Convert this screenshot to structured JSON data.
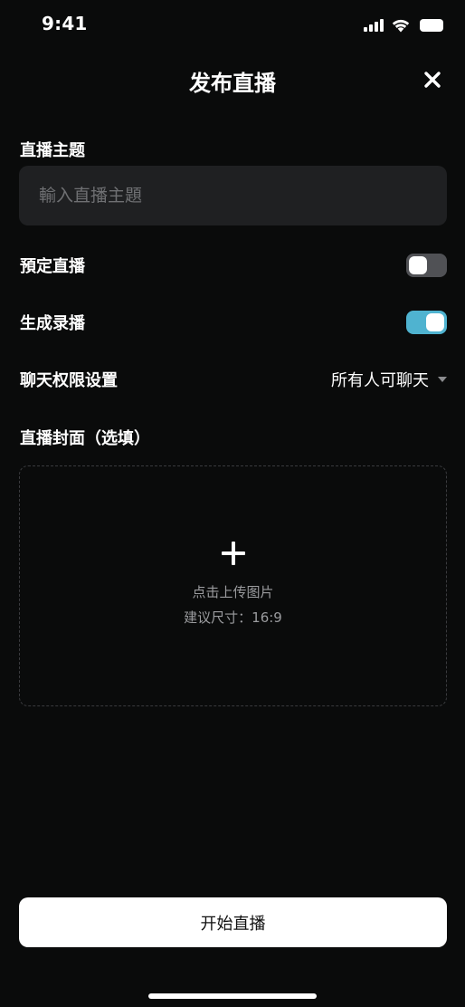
{
  "status_bar": {
    "time": "9:41"
  },
  "header": {
    "title": "发布直播"
  },
  "topic": {
    "label": "直播主题",
    "placeholder": "輸入直播主題",
    "value": ""
  },
  "schedule": {
    "label": "預定直播",
    "enabled": false
  },
  "recording": {
    "label": "生成录播",
    "enabled": true
  },
  "chat_permission": {
    "label": "聊天权限设置",
    "selected": "所有人可聊天"
  },
  "cover": {
    "label": "直播封面（选填）",
    "upload_text": "点击上传图片",
    "hint": "建议尺寸：16:9"
  },
  "start_button": {
    "label": "开始直播"
  },
  "colors": {
    "background": "#0a0b0b",
    "input_bg": "#1f2022",
    "accent": "#4fb3d0",
    "toggle_off": "#505155"
  },
  "icons": {
    "close": "close-icon",
    "upload": "plus-icon",
    "dropdown": "caret-down-icon",
    "wifi": "wifi-icon",
    "signal": "cellular-signal-icon",
    "battery": "battery-icon"
  }
}
